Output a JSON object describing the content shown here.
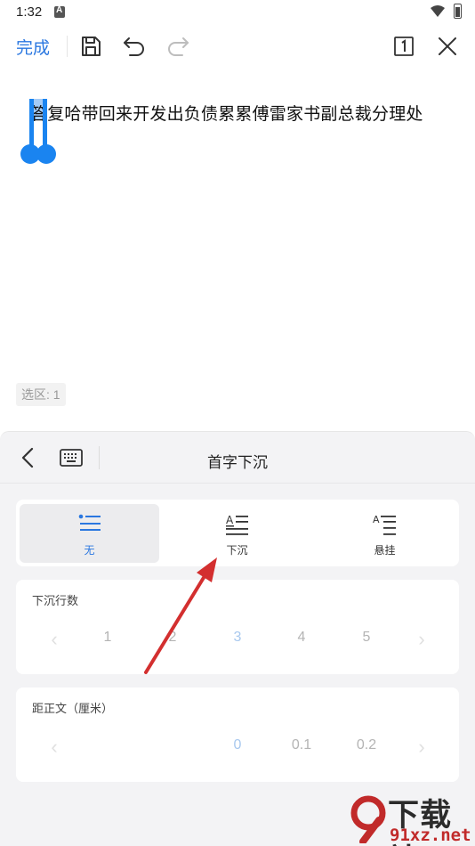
{
  "status_bar": {
    "time": "1:32"
  },
  "toolbar": {
    "done_label": "完成"
  },
  "document": {
    "text": "答复哈带回来开发出负债累累傅雷家书副总裁分理处",
    "selection_label": "选区: 1"
  },
  "panel": {
    "title": "首字下沉",
    "options": [
      {
        "label": "无",
        "selected": true
      },
      {
        "label": "下沉",
        "selected": false
      },
      {
        "label": "悬挂",
        "selected": false
      }
    ],
    "lines": {
      "title": "下沉行数",
      "values": [
        "1",
        "2",
        "3",
        "4",
        "5"
      ],
      "current": "3"
    },
    "distance": {
      "title": "距正文（厘米）",
      "values": [
        "0",
        "0.1",
        "0.2"
      ],
      "current": "0"
    }
  },
  "colors": {
    "accent": "#2a77e0",
    "annotation_arrow": "#d32f2f",
    "panel_bg": "#f3f3f5"
  },
  "watermark": {
    "title": "下载站",
    "url": "91xz.net"
  }
}
